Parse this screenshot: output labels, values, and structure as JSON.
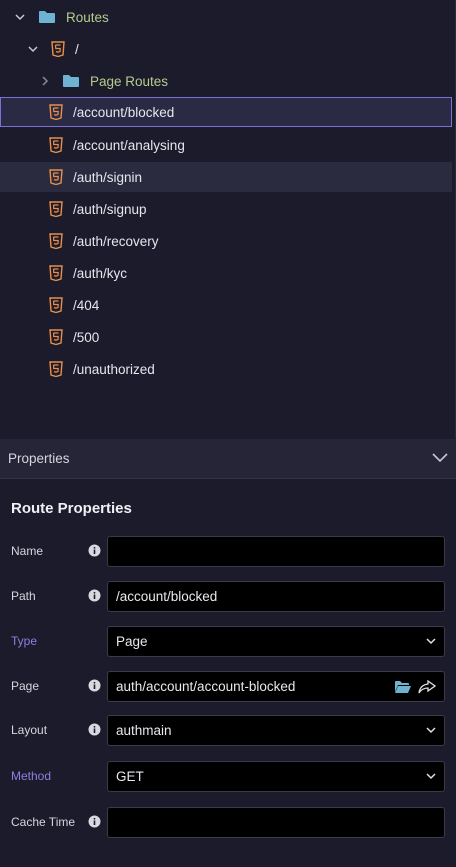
{
  "tree": {
    "root_folder": "Routes",
    "html_root": "/",
    "subfolder": "Page Routes",
    "routes": [
      "/account/blocked",
      "/account/analysing",
      "/auth/signin",
      "/auth/signup",
      "/auth/recovery",
      "/auth/kyc",
      "/404",
      "/500",
      "/unauthorized"
    ]
  },
  "properties_panel": {
    "header": "Properties",
    "section_title": "Route Properties",
    "fields": {
      "name": {
        "label": "Name",
        "value": ""
      },
      "path": {
        "label": "Path",
        "value": "/account/blocked"
      },
      "type": {
        "label": "Type",
        "value": "Page"
      },
      "page": {
        "label": "Page",
        "value": "auth/account/account-blocked"
      },
      "layout": {
        "label": "Layout",
        "value": "authmain"
      },
      "method": {
        "label": "Method",
        "value": "GET"
      },
      "cache_time": {
        "label": "Cache Time",
        "value": ""
      }
    }
  },
  "colors": {
    "folder": "#6fb3d2",
    "html5": "#e8904a",
    "accent": "#7c6fd6",
    "folder_label": "#b5cc8e"
  }
}
